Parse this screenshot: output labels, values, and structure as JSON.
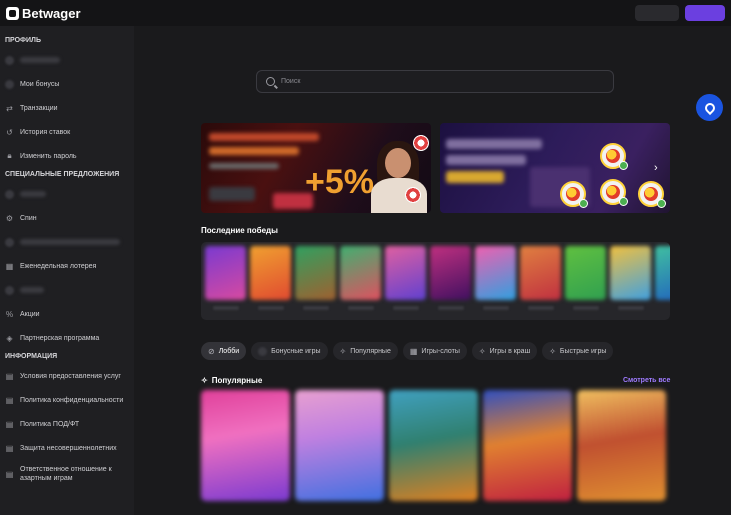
{
  "header": {
    "logo_text": "Betwager",
    "login_button_label": "",
    "signup_button_label": "",
    "colors": {
      "accent": "#6b3fe0",
      "background": "#141416"
    }
  },
  "sidebar": {
    "profile_title": "ПРОФИЛЬ",
    "profile_items": [
      {
        "label": "",
        "icon": "avatar-icon"
      },
      {
        "label": "Мои бонусы",
        "icon": "gift-icon"
      },
      {
        "label": "Транзакции",
        "icon": "arrows-icon"
      },
      {
        "label": "История ставок",
        "icon": "history-icon"
      },
      {
        "label": "Изменить пароль",
        "icon": "lock-icon"
      }
    ],
    "offers_title": "СПЕЦИАЛЬНЫЕ ПРЕДЛОЖЕНИЯ",
    "offer_items": [
      {
        "label": "",
        "icon": "tag-icon"
      },
      {
        "label": "Спин",
        "icon": "wheel-icon"
      },
      {
        "label": "",
        "icon": "tournament-icon"
      },
      {
        "label": "Еженедельная лотерея",
        "icon": "lottery-icon"
      },
      {
        "label": "",
        "icon": "cashback-icon"
      },
      {
        "label": "Акции",
        "icon": "percent-icon"
      },
      {
        "label": "Партнерская программа",
        "icon": "partner-icon"
      }
    ],
    "info_title": "ИНФОРМАЦИЯ",
    "info_items": [
      {
        "label": "Условия предоставления услуг",
        "icon": "document-icon"
      },
      {
        "label": "Политика конфиденциальности",
        "icon": "document-icon"
      },
      {
        "label": "Политика ПОД/ФТ",
        "icon": "document-icon"
      },
      {
        "label": "Защита несовершеннолетних",
        "icon": "document-icon"
      },
      {
        "label": "Ответственное отношение к азартным играм",
        "icon": "document-icon"
      }
    ]
  },
  "search": {
    "placeholder": "Поиск"
  },
  "banners": [
    {
      "name": "welcome-bonus-banner",
      "headline": "+5%"
    },
    {
      "name": "promo-banner"
    }
  ],
  "recent_wins": {
    "title": "Последние победы"
  },
  "tabs": [
    {
      "label": "Лобби",
      "icon": "compass-icon",
      "active": true
    },
    {
      "label": "Бонусные игры",
      "icon": "bonus-icon",
      "active": false
    },
    {
      "label": "Популярные",
      "icon": "sparkle-icon",
      "active": false
    },
    {
      "label": "Игры-слоты",
      "icon": "grid-icon",
      "active": false
    },
    {
      "label": "Игры в краш",
      "icon": "sparkle-icon",
      "active": false
    },
    {
      "label": "Быстрые игры",
      "icon": "sparkle-icon",
      "active": false
    }
  ],
  "popular": {
    "title": "Популярные",
    "see_all_label": "Смотреть все"
  }
}
